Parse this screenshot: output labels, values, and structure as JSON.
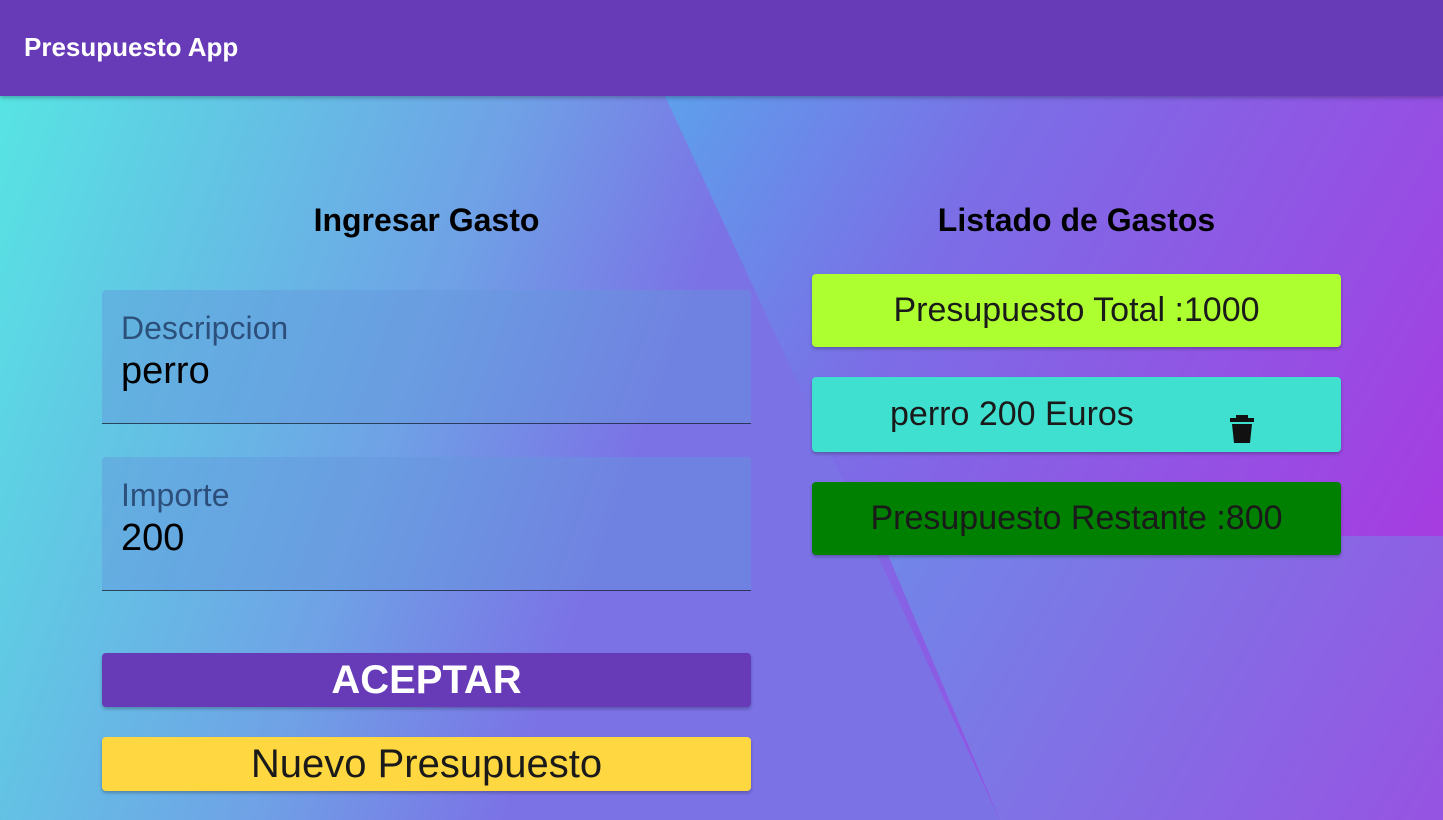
{
  "app": {
    "title": "Presupuesto App"
  },
  "form": {
    "heading": "Ingresar Gasto",
    "description": {
      "label": "Descripcion",
      "value": "perro"
    },
    "amount": {
      "label": "Importe",
      "value": "200"
    },
    "accept_label": "ACEPTAR",
    "new_budget_label": "Nuevo Presupuesto"
  },
  "list": {
    "heading": "Listado de Gastos",
    "total": "Presupuesto Total :1000",
    "expenses": [
      {
        "text": "perro 200 Euros",
        "icon": "trash-icon"
      }
    ],
    "remaining": "Presupuesto Restante :800"
  },
  "colors": {
    "appbar": "#673ab7",
    "accept": "#673ab7",
    "new_budget": "#ffd740",
    "total_card": "#adff2f",
    "expense_card": "#40e0d0",
    "remaining_card": "#008000"
  }
}
